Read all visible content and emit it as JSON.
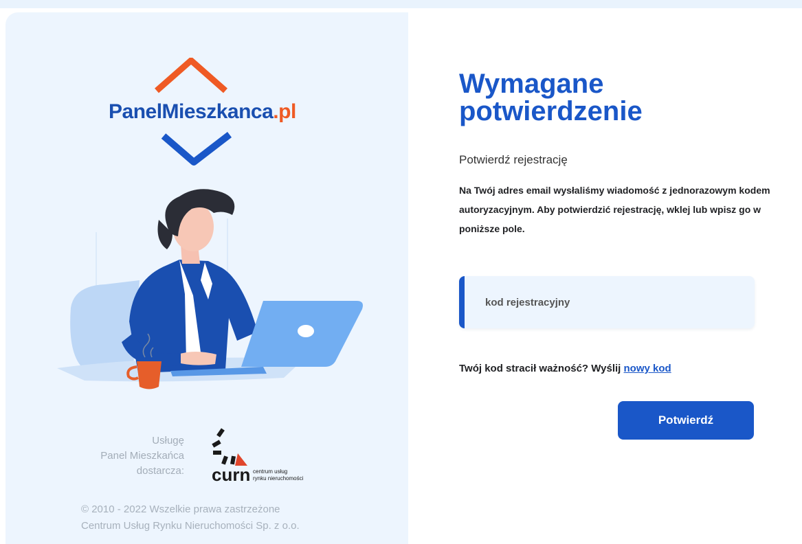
{
  "brand": {
    "logo_main": "PanelMieszkanca",
    "logo_dot": ".",
    "logo_tld": "pl",
    "colors": {
      "blue": "#1a57c8",
      "orange": "#ef5a24",
      "panel_bg": "#edf5fe"
    }
  },
  "provider": {
    "line1": "Usługę",
    "line2": "Panel Mieszkańca",
    "line3": "dostarcza:",
    "logo_word": "curn",
    "logo_sub1": "centrum usług",
    "logo_sub2": "rynku nieruchomości"
  },
  "footer": {
    "line1": "© 2010 - 2022 Wszelkie prawa zastrzeżone",
    "line2": "Centrum Usług Rynku Nieruchomości Sp. z o.o."
  },
  "form": {
    "title_line1": "Wymagane",
    "title_line2": "potwierdzenie",
    "subtitle": "Potwierdź rejestrację",
    "description": "Na Twój adres email wysłaliśmy wiadomość z jednorazowym kodem autoryzacyjnym. Aby potwierdzić rejestrację, wklej lub wpisz go w poniższe pole.",
    "code_placeholder": "kod rejestracyjny",
    "resend_text": "Twój kod stracił ważność? Wyślij ",
    "resend_link": "nowy kod",
    "submit_label": "Potwierdź"
  }
}
